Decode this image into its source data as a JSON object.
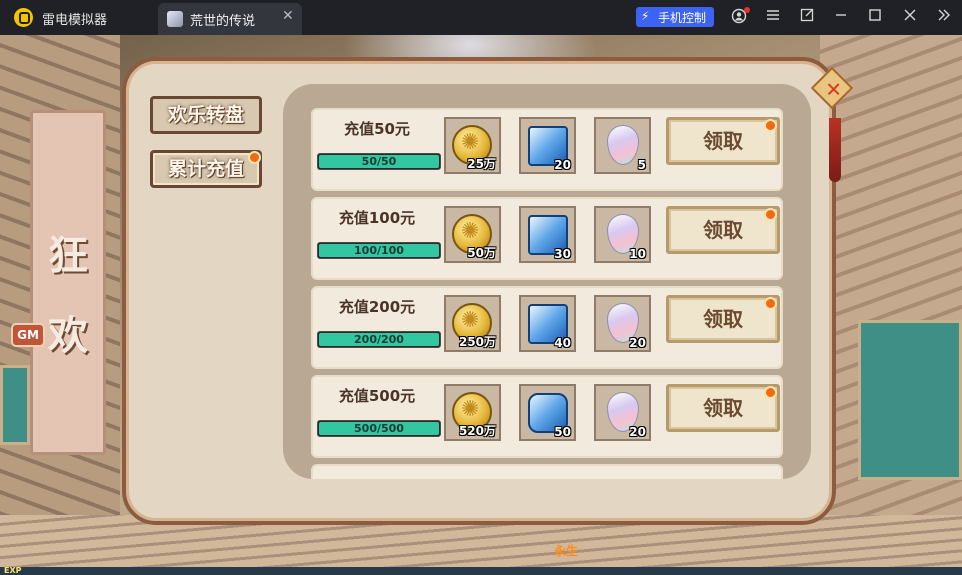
{
  "window": {
    "app_title": "雷电模拟器",
    "tab_title": "荒世的传说",
    "tab_close": "✕",
    "phone_control": "手机控制",
    "icons": [
      "account-icon",
      "menu-icon",
      "popout-icon",
      "minimize-icon",
      "maximize-icon",
      "close-icon",
      "collapse-icon"
    ]
  },
  "game": {
    "banner_chars": [
      "狂",
      "欢"
    ],
    "gm_label": "GM",
    "exp_label": "EXP",
    "player_name": "永生",
    "menu": [
      {
        "label": "欢乐转盘",
        "active": false,
        "notify": false
      },
      {
        "label": "累计充值",
        "active": true,
        "notify": true
      }
    ],
    "close_symbol": "✕",
    "rows": [
      {
        "title": "充值50元",
        "progress_text": "50/50",
        "progress": 1.0,
        "items": [
          {
            "kind": "coin",
            "count": "25万"
          },
          {
            "kind": "gem",
            "count": "20"
          },
          {
            "kind": "crystal",
            "count": "5"
          }
        ],
        "claim": "领取"
      },
      {
        "title": "充值100元",
        "progress_text": "100/100",
        "progress": 1.0,
        "items": [
          {
            "kind": "coin",
            "count": "50万"
          },
          {
            "kind": "gem",
            "count": "30"
          },
          {
            "kind": "crystal",
            "count": "10"
          }
        ],
        "claim": "领取"
      },
      {
        "title": "充值200元",
        "progress_text": "200/200",
        "progress": 1.0,
        "items": [
          {
            "kind": "coin",
            "count": "250万"
          },
          {
            "kind": "gem",
            "count": "40"
          },
          {
            "kind": "crystal",
            "count": "20"
          }
        ],
        "claim": "领取"
      },
      {
        "title": "充值500元",
        "progress_text": "500/500",
        "progress": 1.0,
        "items": [
          {
            "kind": "coin",
            "count": "520万"
          },
          {
            "kind": "gem",
            "count": "50"
          },
          {
            "kind": "crystal",
            "count": "20"
          }
        ],
        "claim": "领取"
      }
    ]
  },
  "colors": {
    "accent_blue": "#3d63f2",
    "progress_fill": "#32c7a0",
    "notify": "#ef6a10",
    "panel_border": "#8d5b3f"
  }
}
